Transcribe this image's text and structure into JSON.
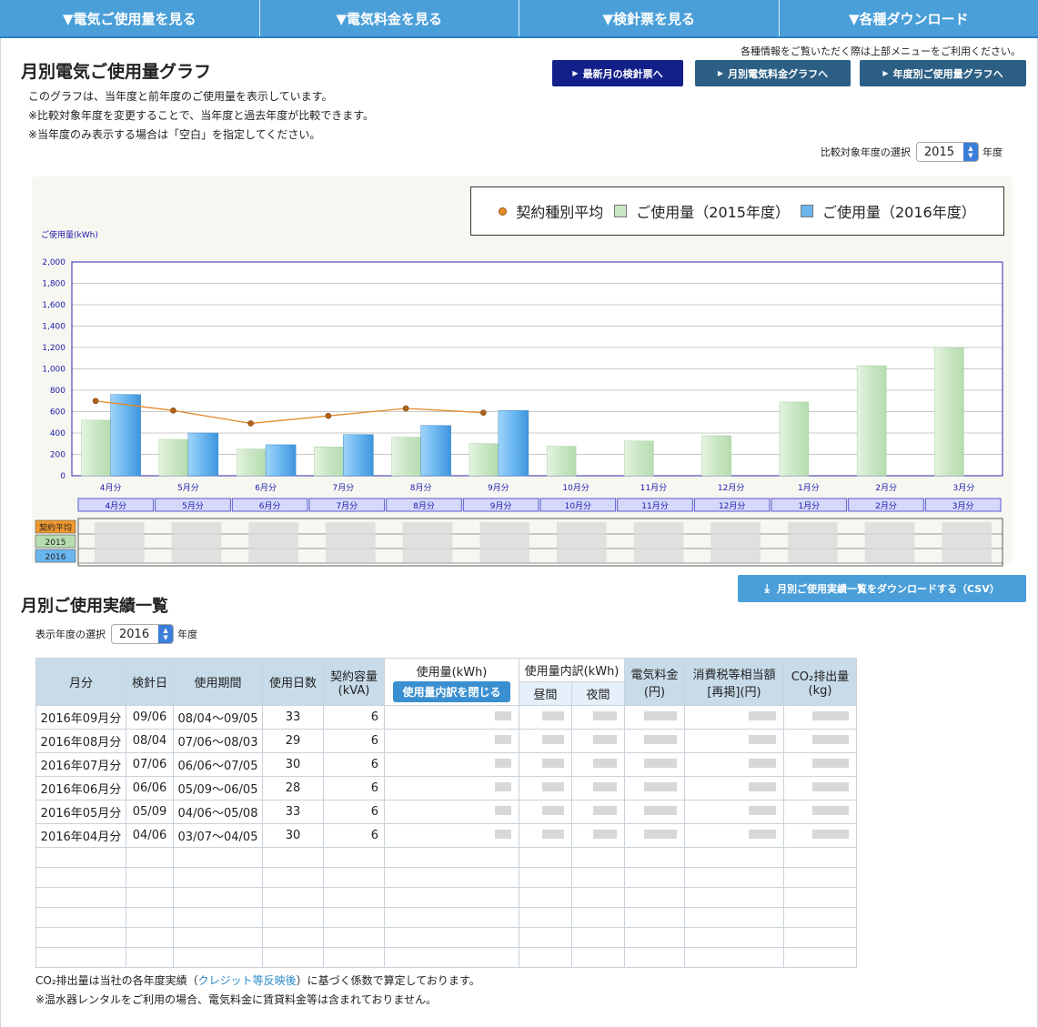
{
  "nav": [
    "▼電気ご使用量を見る",
    "▼電気料金を見る",
    "▼検針票を見る",
    "▼各種ダウンロード"
  ],
  "hint": "各種情報をご覧いただく際は上部メニューをご利用ください。",
  "title": "月別電気ご使用量グラフ",
  "desc": [
    "このグラフは、当年度と前年度のご使用量を表示しています。",
    "※比較対象年度を変更することで、当年度と過去年度が比較できます。",
    "※当年度のみ表示する場合は「空白」を指定してください。"
  ],
  "buttons": {
    "latest": "最新月の検針票へ",
    "fee_graph": "月別電気料金グラフへ",
    "year_graph": "年度別ご使用量グラフへ"
  },
  "compare": {
    "label": "比較対象年度の選択",
    "value": "2015",
    "suffix": "年度"
  },
  "colors": {
    "nav": "#4a9fd9",
    "btn_navy": "#13208a",
    "btn_slate": "#2d5f85",
    "bar2015": "#c9e6c4",
    "bar2016": "#6ab6ef",
    "avg": "#e4892a"
  },
  "legend": {
    "avg": "契約種別平均",
    "s2015": "ご使用量（2015年度）",
    "s2016": "ご使用量（2016年度）"
  },
  "row_labels": [
    "契約平均",
    "2015",
    "2016"
  ],
  "chart_data": {
    "type": "bar",
    "ylabel": "ご使用量(kWh)",
    "ylim": [
      0,
      2000
    ],
    "yticks": [
      "0",
      "200",
      "400",
      "600",
      "800",
      "1,000",
      "1,200",
      "1,400",
      "1,600",
      "1,800",
      "2,000"
    ],
    "categories": [
      "4月分",
      "5月分",
      "6月分",
      "7月分",
      "8月分",
      "9月分",
      "10月分",
      "11月分",
      "12月分",
      "1月分",
      "2月分",
      "3月分"
    ],
    "series": [
      {
        "name": "ご使用量（2015年度）",
        "values": [
          520,
          340,
          250,
          270,
          360,
          300,
          275,
          325,
          375,
          690,
          1030,
          1200
        ]
      },
      {
        "name": "ご使用量（2016年度）",
        "values": [
          760,
          400,
          290,
          385,
          470,
          610,
          null,
          null,
          null,
          null,
          null,
          null
        ]
      },
      {
        "name": "契約種別平均",
        "values": [
          700,
          610,
          490,
          560,
          630,
          590,
          null,
          null,
          null,
          null,
          null,
          null
        ]
      }
    ]
  },
  "list": {
    "title": "月別ご使用実績一覧",
    "csv": "月別ご使用実績一覧をダウンロードする（CSV）",
    "year_label": "表示年度の選択",
    "year_value": "2016",
    "year_suffix": "年度",
    "headers": {
      "month": "月分",
      "meter_day": "検針日",
      "period": "使用期間",
      "days": "使用日数",
      "capacity": "契約容量",
      "capacity_unit": "(kVA)",
      "usage": "使用量(kWh)",
      "close": "使用量内訳を閉じる",
      "breakdown": "使用量内訳(kWh)",
      "day": "昼間",
      "night": "夜間",
      "fee": "電気料金",
      "fee_unit": "(円)",
      "tax": "消費税等相当額",
      "tax_unit": "[再掲](円)",
      "co2": "CO₂排出量",
      "co2_unit": "(kg)"
    },
    "rows": [
      {
        "month": "2016年09月分",
        "meter_day": "09/06",
        "period": "08/04〜09/05",
        "days": "33",
        "capacity": "6"
      },
      {
        "month": "2016年08月分",
        "meter_day": "08/04",
        "period": "07/06〜08/03",
        "days": "29",
        "capacity": "6"
      },
      {
        "month": "2016年07月分",
        "meter_day": "07/06",
        "period": "06/06〜07/05",
        "days": "30",
        "capacity": "6"
      },
      {
        "month": "2016年06月分",
        "meter_day": "06/06",
        "period": "05/09〜06/05",
        "days": "28",
        "capacity": "6"
      },
      {
        "month": "2016年05月分",
        "meter_day": "05/09",
        "period": "04/06〜05/08",
        "days": "33",
        "capacity": "6"
      },
      {
        "month": "2016年04月分",
        "meter_day": "04/06",
        "period": "03/07〜04/05",
        "days": "30",
        "capacity": "6"
      }
    ],
    "empty_rows": 6
  },
  "footnote": {
    "line1_pre": "CO₂排出量は当社の各年度実績（",
    "line1_link": "クレジット等反映後",
    "line1_post": "）に基づく係数で算定しております。",
    "line2": "※温水器レンタルをご利用の場合、電気料金に賃貸料金等は含まれておりません。"
  }
}
